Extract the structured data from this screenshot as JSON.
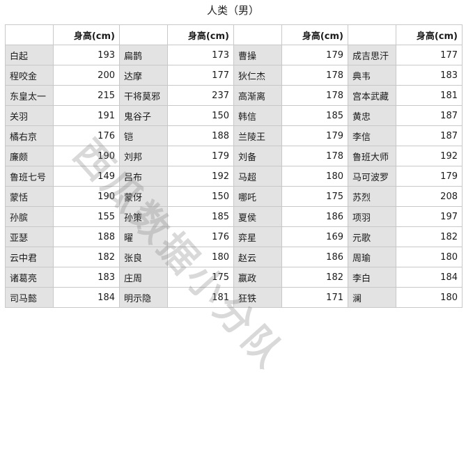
{
  "title": "人类（男）",
  "header": {
    "name_label": "",
    "value_label": "身高(cm)"
  },
  "watermark": "西瓜数据小分队",
  "rows": [
    [
      [
        "白起",
        "193"
      ],
      [
        "扁鹊",
        "173"
      ],
      [
        "曹操",
        "179"
      ],
      [
        "成吉思汗",
        "177"
      ]
    ],
    [
      [
        "程咬金",
        "200"
      ],
      [
        "达摩",
        "177"
      ],
      [
        "狄仁杰",
        "178"
      ],
      [
        "典韦",
        "183"
      ]
    ],
    [
      [
        "东皇太一",
        "215"
      ],
      [
        "干将莫邪",
        "237"
      ],
      [
        "高渐离",
        "178"
      ],
      [
        "宫本武藏",
        "181"
      ]
    ],
    [
      [
        "关羽",
        "191"
      ],
      [
        "鬼谷子",
        "150"
      ],
      [
        "韩信",
        "185"
      ],
      [
        "黄忠",
        "187"
      ]
    ],
    [
      [
        "橘右京",
        "176"
      ],
      [
        "铠",
        "188"
      ],
      [
        "兰陵王",
        "179"
      ],
      [
        "李信",
        "187"
      ]
    ],
    [
      [
        "廉颇",
        "190"
      ],
      [
        "刘邦",
        "179"
      ],
      [
        "刘备",
        "178"
      ],
      [
        "鲁班大师",
        "192"
      ]
    ],
    [
      [
        "鲁班七号",
        "149"
      ],
      [
        "吕布",
        "192"
      ],
      [
        "马超",
        "180"
      ],
      [
        "马可波罗",
        "179"
      ]
    ],
    [
      [
        "蒙恬",
        "190"
      ],
      [
        "蒙伢",
        "150"
      ],
      [
        "哪吒",
        "175"
      ],
      [
        "苏烈",
        "208"
      ]
    ],
    [
      [
        "孙膑",
        "155"
      ],
      [
        "孙策",
        "185"
      ],
      [
        "夏侯",
        "186"
      ],
      [
        "项羽",
        "197"
      ]
    ],
    [
      [
        "亚瑟",
        "188"
      ],
      [
        "曜",
        "176"
      ],
      [
        "弈星",
        "169"
      ],
      [
        "元歌",
        "182"
      ]
    ],
    [
      [
        "云中君",
        "182"
      ],
      [
        "张良",
        "180"
      ],
      [
        "赵云",
        "186"
      ],
      [
        "周瑜",
        "180"
      ]
    ],
    [
      [
        "诸葛亮",
        "183"
      ],
      [
        "庄周",
        "175"
      ],
      [
        "嬴政",
        "182"
      ],
      [
        "李白",
        "184"
      ]
    ],
    [
      [
        "司马懿",
        "184"
      ],
      [
        "明示隐",
        "181"
      ],
      [
        "狂铁",
        "171"
      ],
      [
        "澜",
        "180"
      ]
    ]
  ]
}
